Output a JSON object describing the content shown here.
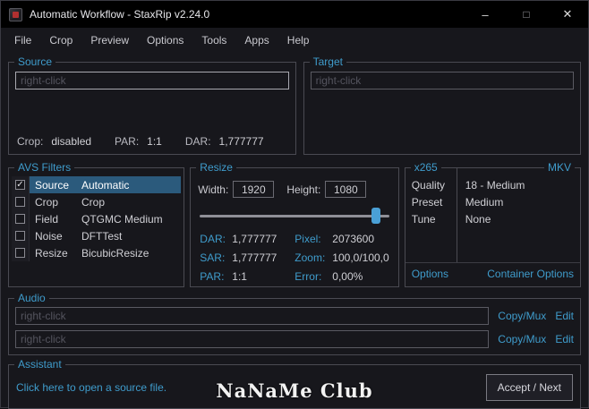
{
  "window": {
    "title": "Automatic Workflow - StaxRip v2.24.0",
    "icons": {
      "minimize": "–",
      "maximize": "□",
      "close": "✕"
    }
  },
  "menu": [
    "File",
    "Crop",
    "Preview",
    "Options",
    "Tools",
    "Apps",
    "Help"
  ],
  "source": {
    "label": "Source",
    "placeholder": "right-click",
    "stats": [
      {
        "k": "Crop:",
        "v": "disabled"
      },
      {
        "k": "PAR:",
        "v": "1:1"
      },
      {
        "k": "DAR:",
        "v": "1,777777"
      }
    ]
  },
  "target": {
    "label": "Target",
    "placeholder": "right-click"
  },
  "avs_filters": {
    "label": "AVS Filters",
    "rows": [
      {
        "check": "✓",
        "name": "Source",
        "value": "Automatic"
      },
      {
        "check": "",
        "name": "Crop",
        "value": "Crop"
      },
      {
        "check": "",
        "name": "Field",
        "value": "QTGMC Medium"
      },
      {
        "check": "",
        "name": "Noise",
        "value": "DFTTest"
      },
      {
        "check": "",
        "name": "Resize",
        "value": "BicubicResize"
      }
    ]
  },
  "resize": {
    "label": "Resize",
    "width_label": "Width:",
    "width_value": "1920",
    "height_label": "Height:",
    "height_value": "1080",
    "slider_percent": 93,
    "stats": [
      {
        "k1": "DAR:",
        "v1": "1,777777",
        "k2": "Pixel:",
        "v2": "2073600"
      },
      {
        "k1": "SAR:",
        "v1": "1,777777",
        "k2": "Zoom:",
        "v2": "100,0/100,0"
      },
      {
        "k1": "PAR:",
        "v1": "1:1",
        "k2": "Error:",
        "v2": "0,00%"
      }
    ]
  },
  "x265": {
    "label": "x265",
    "right_label": "MKV",
    "rows": [
      {
        "k": "Quality",
        "v": "18 - Medium"
      },
      {
        "k": "Preset",
        "v": "Medium"
      },
      {
        "k": "Tune",
        "v": "None"
      }
    ],
    "options_link": "Options",
    "container_link": "Container Options"
  },
  "audio": {
    "label": "Audio",
    "tracks": [
      {
        "placeholder": "right-click",
        "copy_link": "Copy/Mux",
        "edit_link": "Edit"
      },
      {
        "placeholder": "right-click",
        "copy_link": "Copy/Mux",
        "edit_link": "Edit"
      }
    ]
  },
  "assistant": {
    "label": "Assistant",
    "link": "Click here to open a source file.",
    "button": "Accept / Next"
  },
  "watermark": "NaNaMe Club",
  "colors": {
    "accent": "#3f9ccc",
    "selection": "#2b5a7c"
  }
}
